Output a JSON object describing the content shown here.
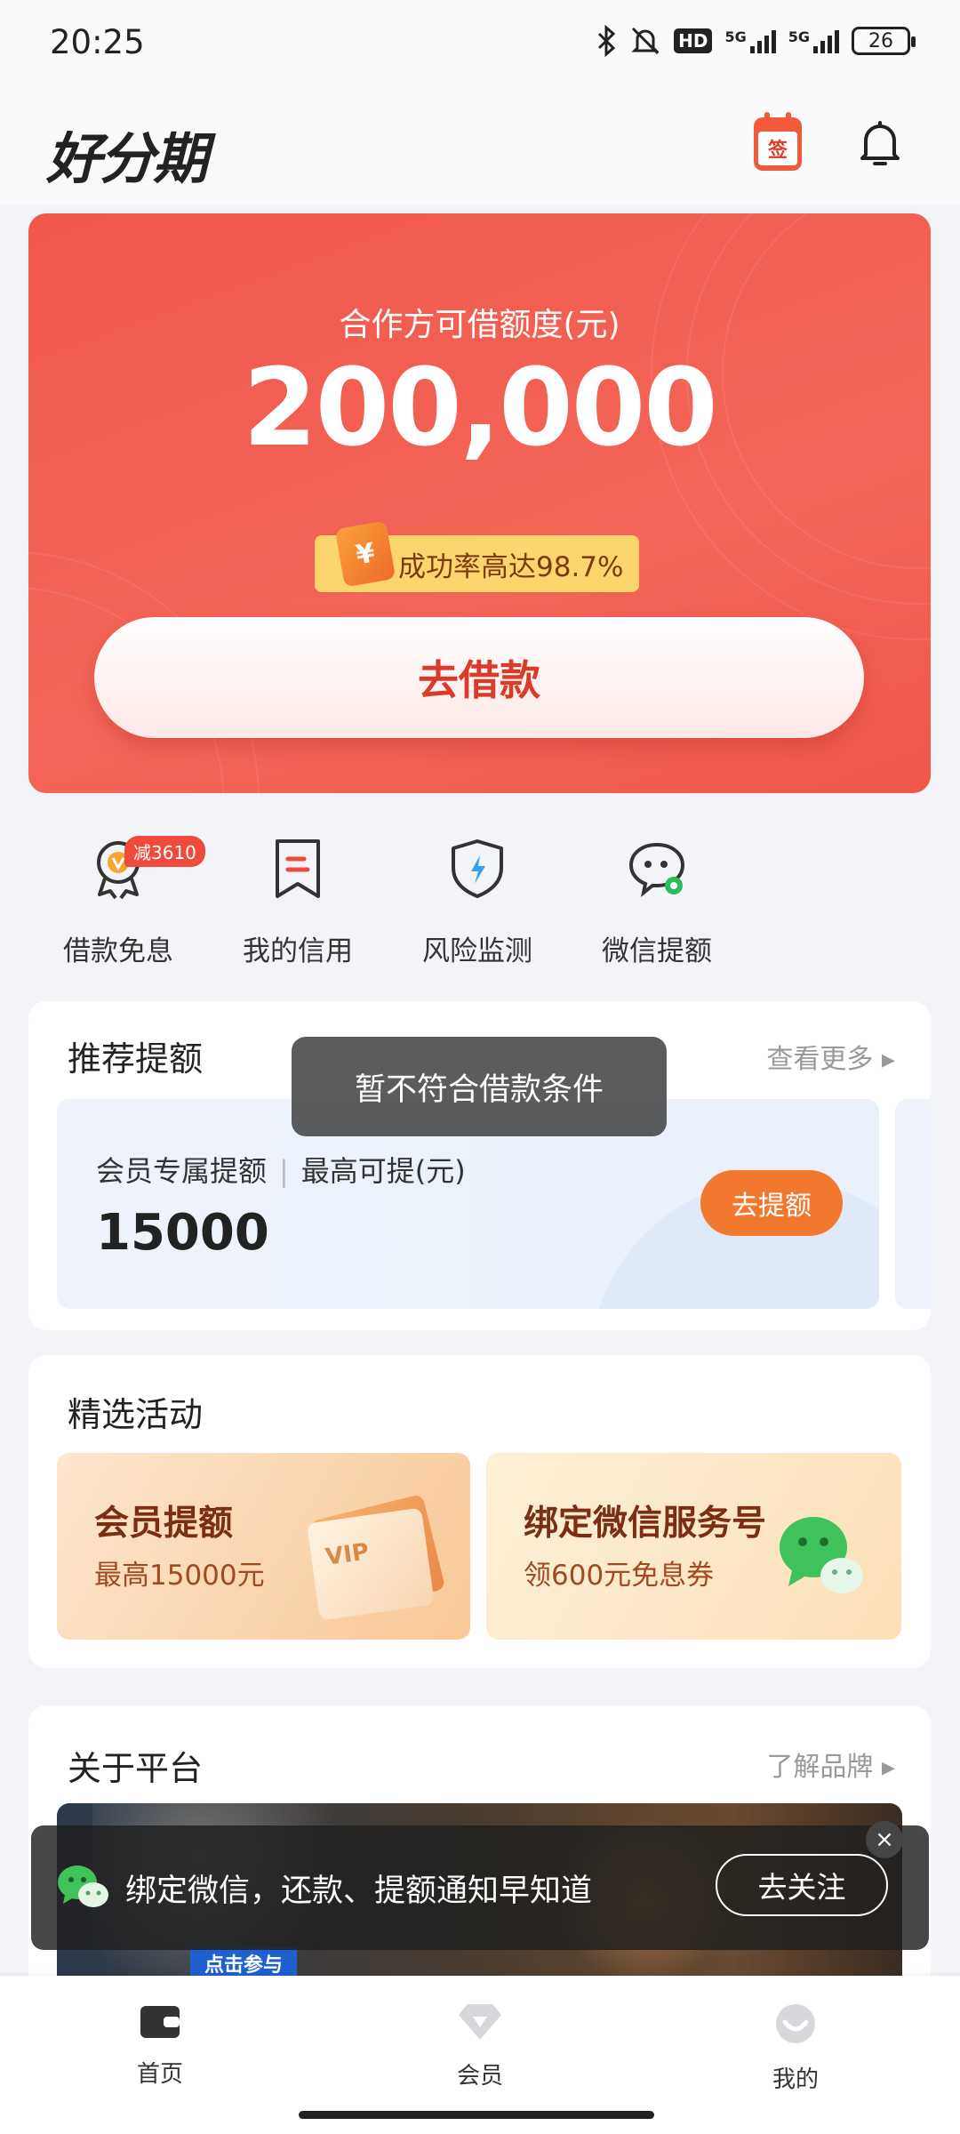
{
  "status_bar": {
    "time": "20:25",
    "battery": "26",
    "hd": "HD",
    "net1": "5G",
    "net2": "5G"
  },
  "header": {
    "logo": "好分期",
    "checkin_icon_text": "签"
  },
  "hero": {
    "label": "合作方可借额度(元)",
    "amount": "200,000",
    "rate_badge": "成功率高达98.7%",
    "coin_symbol": "¥",
    "borrow_button": "去借款"
  },
  "quick_actions": {
    "badge": "减3610",
    "items": [
      {
        "label": "借款免息",
        "icon": "v-medal-icon"
      },
      {
        "label": "我的信用",
        "icon": "bookmark-icon"
      },
      {
        "label": "风险监测",
        "icon": "shield-bolt-icon"
      },
      {
        "label": "微信提额",
        "icon": "wechat-chat-icon"
      }
    ]
  },
  "recommend": {
    "title": "推荐提额",
    "more": "查看更多 ▸",
    "line1": "会员专属提额",
    "line1_right": "最高可提(元)",
    "value": "15000",
    "button": "去提额"
  },
  "toast": "暂不符合借款条件",
  "activities": {
    "title": "精选活动",
    "items": [
      {
        "title": "会员提额",
        "subtitle": "最高15000元",
        "art": "VIP"
      },
      {
        "title": "绑定微信服务号",
        "subtitle": "领600元免息券"
      }
    ]
  },
  "about": {
    "title": "关于平台",
    "more": "了解品牌 ▸",
    "banner_cta": "点击参与"
  },
  "wechat_bar": {
    "text": "绑定微信，还款、提额通知早知道",
    "button": "去关注",
    "close": "×"
  },
  "tabs": [
    {
      "label": "首页",
      "icon": "wallet-icon"
    },
    {
      "label": "会员",
      "icon": "diamond-icon"
    },
    {
      "label": "我的",
      "icon": "smile-icon"
    }
  ]
}
